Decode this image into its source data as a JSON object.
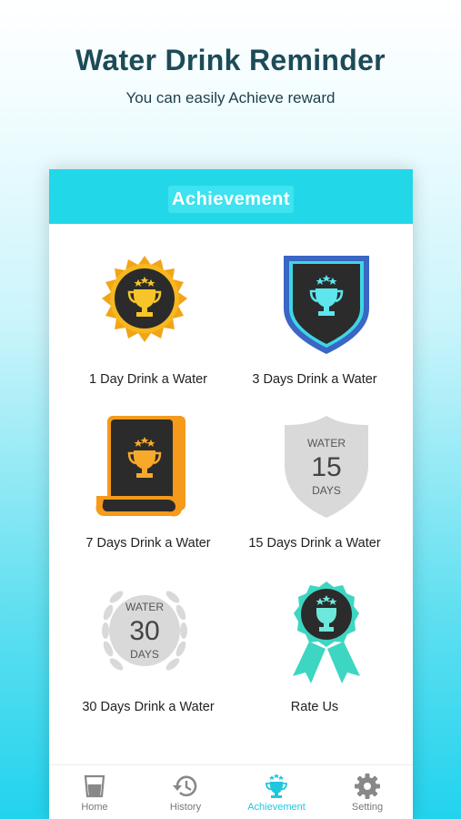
{
  "promo": {
    "title": "Water Drink Reminder",
    "subtitle": "You can easily Achieve reward"
  },
  "appbar": {
    "title": "Achievement"
  },
  "achievements": [
    {
      "label": "1 Day Drink a Water",
      "icon": "gold-sun-trophy-badge-icon"
    },
    {
      "label": "3 Days Drink a Water",
      "icon": "blue-shield-trophy-badge-icon"
    },
    {
      "label": "7 Days Drink a Water",
      "icon": "orange-scroll-trophy-badge-icon"
    },
    {
      "label": "15 Days Drink a Water",
      "icon": "grey-shield-15-days-icon",
      "badge_text": {
        "top": "WATER",
        "num": "15",
        "bottom": "DAYS"
      }
    },
    {
      "label": "30 Days Drink a Water",
      "icon": "grey-laurel-30-days-icon",
      "badge_text": {
        "top": "WATER",
        "num": "30",
        "bottom": "DAYS"
      }
    },
    {
      "label": "Rate Us",
      "icon": "teal-ribbon-trophy-badge-icon"
    }
  ],
  "nav": {
    "items": [
      {
        "label": "Home",
        "icon": "glass-icon"
      },
      {
        "label": "History",
        "icon": "history-icon"
      },
      {
        "label": "Achievement",
        "icon": "trophy-icon",
        "active": true
      },
      {
        "label": "Setting",
        "icon": "gear-icon"
      }
    ]
  },
  "colors": {
    "accent": "#22d7e8",
    "active_nav": "#20c7dc",
    "title_text": "#1d4b57"
  }
}
